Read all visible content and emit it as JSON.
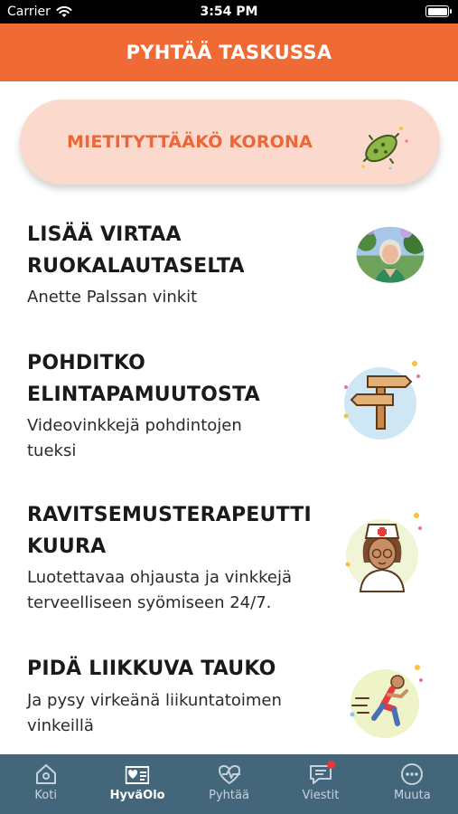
{
  "status_bar": {
    "carrier": "Carrier",
    "time": "3:54 PM"
  },
  "header": {
    "title": "PYHTÄÄ TASKUSSA"
  },
  "banner": {
    "label": "MIETITYTTÄÄKÖ KORONA",
    "icon": "virus-icon"
  },
  "items": [
    {
      "title_line1": "LISÄÄ VIRTAA",
      "title_line2": "RUOKALAUTASELTA",
      "subtitle_line1": "Anette Palssan vinkit",
      "subtitle_line2": "",
      "icon": "person-photo"
    },
    {
      "title_line1": "POHDITKO",
      "title_line2": "ELINTAPAMUUTOSTA",
      "subtitle_line1": "Videovinkkejä pohdintojen",
      "subtitle_line2": "tueksi",
      "icon": "signpost-icon"
    },
    {
      "title_line1": "RAVITSEMUSTERAPEUTTI",
      "title_line2": "KUURA",
      "subtitle_line1": "Luotettavaa ohjausta ja vinkkejä",
      "subtitle_line2": "terveelliseen syömiseen 24/7.",
      "icon": "nurse-icon"
    },
    {
      "title_line1": "PIDÄ LIIKKUVA TAUKO",
      "title_line2": "",
      "subtitle_line1": "Ja pysy virkeänä liikuntatoimen",
      "subtitle_line2": "vinkeillä",
      "icon": "runner-icon"
    }
  ],
  "tabs": [
    {
      "label": "Koti",
      "icon": "home-icon"
    },
    {
      "label": "HyväOlo",
      "icon": "heart-card-icon"
    },
    {
      "label": "Pyhtää",
      "icon": "heart-pulse-icon"
    },
    {
      "label": "Viestit",
      "icon": "message-icon"
    },
    {
      "label": "Muuta",
      "icon": "more-icon"
    }
  ],
  "colors": {
    "brand": "#f06a35",
    "banner_bg": "#fcd9cd",
    "tab_bar": "#44667a",
    "badge": "#e8393b"
  }
}
